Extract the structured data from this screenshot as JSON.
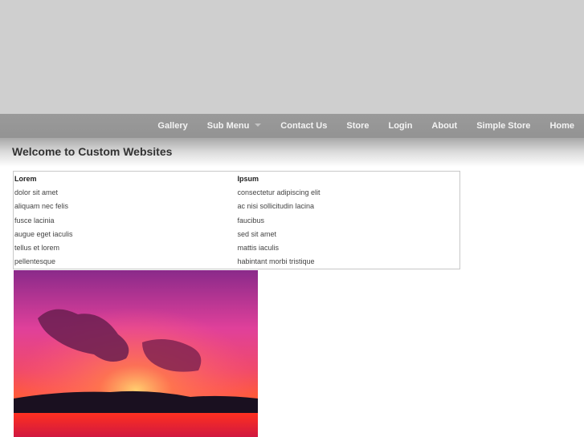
{
  "nav": {
    "items": [
      "Gallery",
      "Sub Menu",
      "Contact Us",
      "Store",
      "Login",
      "About",
      "Simple Store",
      "Home"
    ]
  },
  "page_title": "Welcome to Custom Websites",
  "table": {
    "headers": [
      "Lorem",
      "Ipsum"
    ],
    "rows": [
      [
        "dolor sit amet",
        "consectetur adipiscing elit"
      ],
      [
        "aliquam nec felis",
        "ac nisi sollicitudin lacina"
      ],
      [
        "fusce lacinia",
        "faucibus"
      ],
      [
        "augue eget iaculis",
        "sed sit amet"
      ],
      [
        "tellus et lorem",
        "mattis iaculis"
      ],
      [
        "pellentesque",
        "habintant morbi tristique"
      ]
    ]
  }
}
